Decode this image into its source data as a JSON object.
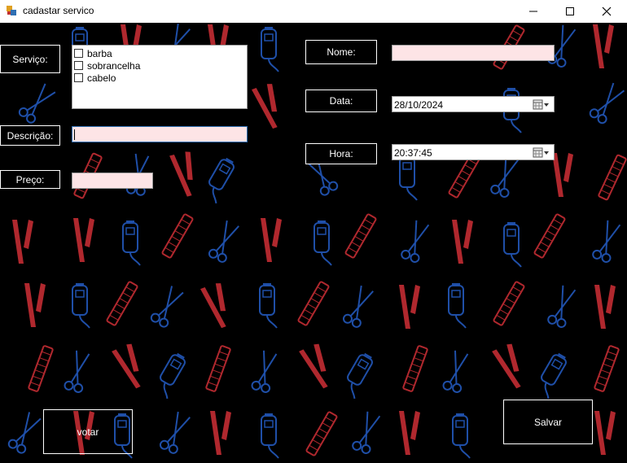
{
  "window": {
    "title": "cadastar servico",
    "icon": "app-form-icon"
  },
  "form": {
    "servico_label": "Serviço:",
    "servicos": [
      "barba",
      "sobrancelha",
      "cabelo"
    ],
    "descricao_label": "Descrição:",
    "descricao_value": "",
    "preco_label": "Preço:",
    "preco_value": "",
    "nome_label": "Nome:",
    "nome_value": "",
    "data_label": "Data:",
    "data_value": "28/10/2024",
    "hora_label": "Hora:",
    "hora_value": "20:37:45"
  },
  "buttons": {
    "voltar": "votar",
    "salvar": "Salvar"
  },
  "colors": {
    "background": "#000000",
    "input_fill": "#fde4e6",
    "pattern_red": "#b0282e",
    "pattern_blue": "#1f4fa8"
  }
}
